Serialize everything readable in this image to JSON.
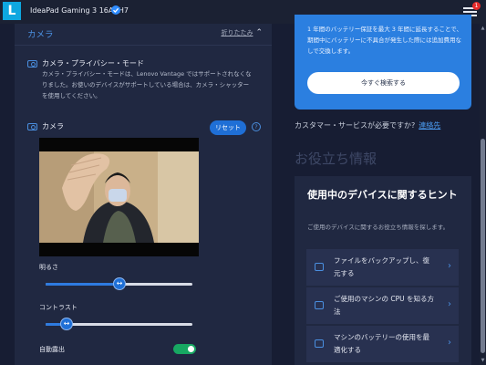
{
  "titlebar": {
    "device_name": "IdeaPad Gaming 3 16ARH7",
    "menu_badge": "1"
  },
  "camera_section": {
    "title": "カメラ",
    "collapse_label": "折りたたみ",
    "privacy_title": "カメラ・プライバシー・モード",
    "privacy_desc": "カメラ・プライバシー・モードは、Lenovo Vantage ではサポートされなくなりました。お使いのデバイスがサポートしている場合は、カメラ・シャッターを使用してください。",
    "camera_label": "カメラ",
    "reset_label": "リセット",
    "help_symbol": "?",
    "brightness_label": "明るさ",
    "brightness_level": 0.5,
    "contrast_label": "コントラスト",
    "contrast_level": 0.14,
    "auto_exposure_label": "自動露出",
    "auto_exposure_on": true
  },
  "right_pane": {
    "warranty_text": "1 年間のバッテリー保証を最大 3 年間に延長することで、期間中にバッテリーに不具合が発生した際には追加費用なしで交換します。",
    "search_button": "今すぐ検索する",
    "customer_service_text": "カスタマー・サービスが必要ですか?",
    "contact_link": "連絡先",
    "helpful_heading": "お役立ち情報",
    "hints_title": "使用中のデバイスに関するヒント",
    "hints_sub": "ご使用のデバイスに関するお役立ち情報を探します。",
    "tips": [
      {
        "label": "ファイルをバックアップし、復元する",
        "icon": "cloud-upload-icon"
      },
      {
        "label": "ご使用のマシンの CPU を知る方法",
        "icon": "laptop-icon"
      },
      {
        "label": "マシンのバッテリーの使用を最適化する",
        "icon": "battery-icon"
      }
    ]
  },
  "colors": {
    "accent": "#2b7fe0",
    "background": "#171d33",
    "panel": "#202841",
    "toggle_on": "#17a862"
  }
}
